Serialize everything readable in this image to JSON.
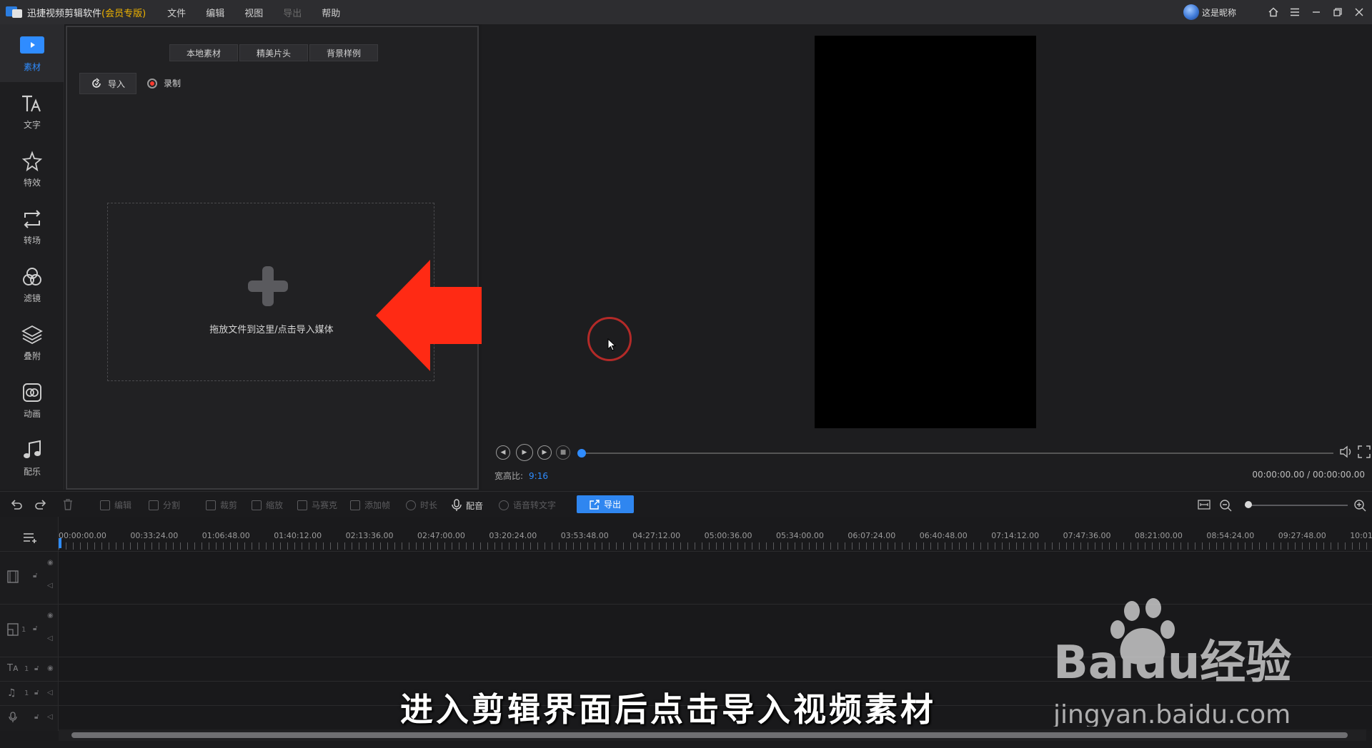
{
  "titlebar": {
    "app_name": "迅捷视频剪辑软件",
    "edition": "(会员专版)",
    "menu": [
      {
        "label": "文件",
        "enabled": true
      },
      {
        "label": "编辑",
        "enabled": true
      },
      {
        "label": "视图",
        "enabled": true
      },
      {
        "label": "导出",
        "enabled": false
      },
      {
        "label": "帮助",
        "enabled": true
      }
    ],
    "user_name": "这是昵称"
  },
  "sidebar": {
    "items": [
      {
        "label": "素材",
        "icon": "media-icon",
        "active": true
      },
      {
        "label": "文字",
        "icon": "text-icon",
        "active": false
      },
      {
        "label": "特效",
        "icon": "star-effect-icon",
        "active": false
      },
      {
        "label": "转场",
        "icon": "transition-icon",
        "active": false
      },
      {
        "label": "滤镜",
        "icon": "filter-icon",
        "active": false
      },
      {
        "label": "叠附",
        "icon": "layers-icon",
        "active": false
      },
      {
        "label": "动画",
        "icon": "animation-icon",
        "active": false
      },
      {
        "label": "配乐",
        "icon": "music-icon",
        "active": false
      }
    ]
  },
  "media": {
    "tabs": [
      "本地素材",
      "精美片头",
      "背景样例"
    ],
    "import_label": "导入",
    "record_label": "录制",
    "drop_text": "拖放文件到这里/点击导入媒体"
  },
  "preview": {
    "aspect_label": "宽高比:",
    "aspect_value": "9:16",
    "time": "00:00:00.00 / 00:00:00.00",
    "progress": 0
  },
  "edit_toolbar": {
    "tools": [
      {
        "label": "编辑",
        "enabled": false
      },
      {
        "label": "分割",
        "enabled": false
      },
      {
        "label": "裁剪",
        "enabled": false
      },
      {
        "label": "缩放",
        "enabled": false
      },
      {
        "label": "马赛克",
        "enabled": false
      },
      {
        "label": "添加帧",
        "enabled": false
      },
      {
        "label": "时长",
        "enabled": false
      },
      {
        "label": "配音",
        "enabled": true
      },
      {
        "label": "语音转文字",
        "enabled": false
      }
    ],
    "export_label": "导出",
    "zoom": 0
  },
  "timeline": {
    "ticks": [
      "00:00:00.00",
      "00:33:24.00",
      "01:06:48.00",
      "01:40:12.00",
      "02:13:36.00",
      "02:47:00.00",
      "03:20:24.00",
      "03:53:48.00",
      "04:27:12.00",
      "05:00:36.00",
      "05:34:00.00",
      "06:07:24.00",
      "06:40:48.00",
      "07:14:12.00",
      "07:47:36.00",
      "08:21:00.00",
      "08:54:24.00",
      "09:27:48.00",
      "10:01:"
    ],
    "tracks": [
      {
        "type": "video",
        "icon": "film-icon",
        "number": ""
      },
      {
        "type": "picture-in-picture",
        "icon": "pip-icon",
        "number": "1"
      },
      {
        "type": "text",
        "icon": "text-track-icon",
        "number": "1"
      },
      {
        "type": "music",
        "icon": "music-track-icon",
        "number": "1"
      },
      {
        "type": "voice",
        "icon": "mic-track-icon",
        "number": ""
      }
    ]
  },
  "overlay": {
    "subtitle": "进入剪辑界面后点击导入视频素材",
    "watermark_brand": "Baidu经验",
    "watermark_url": "jingyan.baidu.com"
  },
  "colors": {
    "accent": "#2f8cff",
    "vip": "#f0b400",
    "arrow": "#ff2a14"
  }
}
